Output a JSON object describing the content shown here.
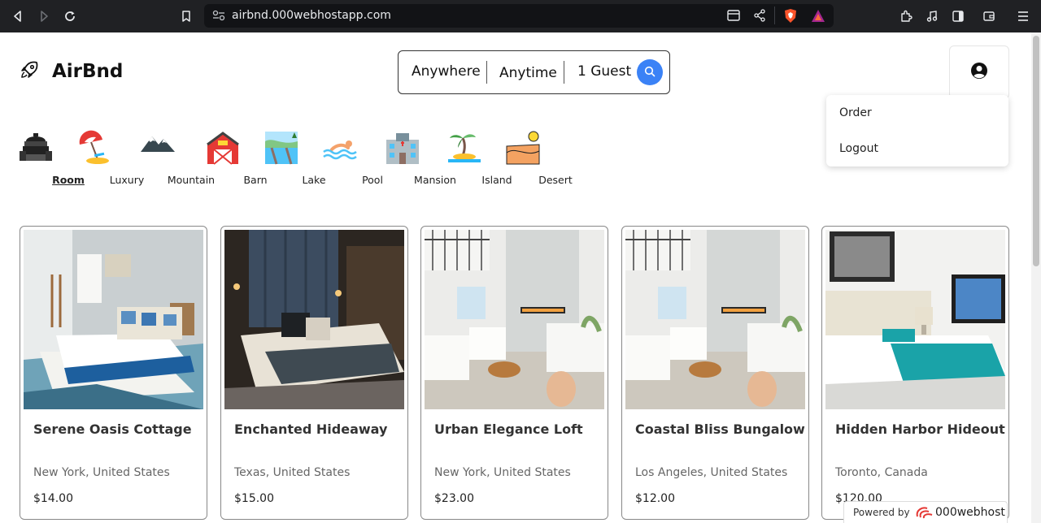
{
  "browser": {
    "url": "airbnd.000webhostapp.com"
  },
  "header": {
    "logo_text": "AirBnd",
    "search": {
      "where": "Anywhere",
      "when": "Anytime",
      "guests": "1 Guest"
    }
  },
  "user_menu": {
    "items": [
      {
        "label": "Order"
      },
      {
        "label": "Logout"
      }
    ]
  },
  "categories": [
    {
      "label": "Room",
      "icon": "room-icon",
      "active": true
    },
    {
      "label": "Luxury",
      "icon": "beach-umbrella-icon",
      "active": false
    },
    {
      "label": "Mountain",
      "icon": "mountain-icon",
      "active": false
    },
    {
      "label": "Barn",
      "icon": "barn-icon",
      "active": false
    },
    {
      "label": "Lake",
      "icon": "lake-icon",
      "active": false
    },
    {
      "label": "Pool",
      "icon": "pool-icon",
      "active": false
    },
    {
      "label": "Mansion",
      "icon": "mansion-icon",
      "active": false
    },
    {
      "label": "Island",
      "icon": "island-icon",
      "active": false
    },
    {
      "label": "Desert",
      "icon": "desert-icon",
      "active": false
    }
  ],
  "listings": [
    {
      "title": "Serene Oasis Cottage",
      "location": "New York, United States",
      "price": "$14.00"
    },
    {
      "title": "Enchanted Hideaway",
      "location": "Texas, United States",
      "price": "$15.00"
    },
    {
      "title": "Urban Elegance Loft",
      "location": "New York, United States",
      "price": "$23.00"
    },
    {
      "title": "Coastal Bliss Bungalow",
      "location": "Los Angeles, United States",
      "price": "$12.00"
    },
    {
      "title": "Hidden Harbor Hideout",
      "location": "Toronto, Canada",
      "price": "$120.00"
    }
  ],
  "footer_badge": {
    "powered_by": "Powered by",
    "brand": "000webhost"
  },
  "colors": {
    "accent": "#3b82f6",
    "chrome": "#202124"
  }
}
